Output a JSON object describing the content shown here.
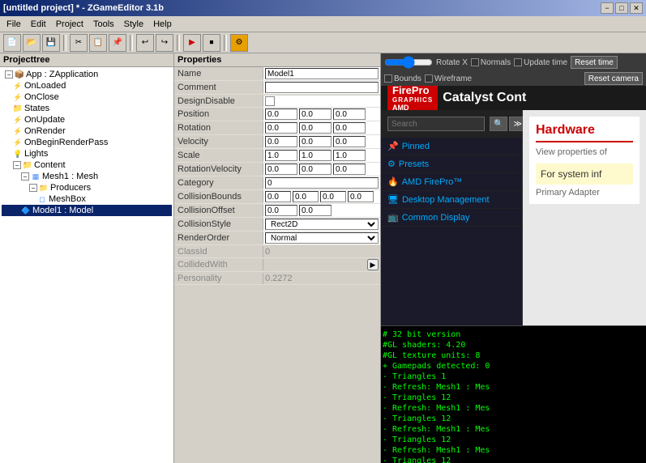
{
  "window": {
    "title": "[untitled project] * - ZGameEditor 3.1b",
    "min_btn": "−",
    "max_btn": "□",
    "close_btn": "✕"
  },
  "menu": {
    "items": [
      "File",
      "Edit",
      "Project",
      "Tools",
      "Style",
      "Help"
    ]
  },
  "toolbar": {
    "buttons": [
      "📁",
      "💾",
      "✂",
      "📋",
      "⎌",
      "⎚",
      "▶",
      "⏹",
      "🔍",
      "⚙"
    ]
  },
  "project_tree": {
    "header": "Projecttree",
    "items": [
      {
        "label": "App : ZApplication",
        "level": 0,
        "expanded": true,
        "icon": "app"
      },
      {
        "label": "OnLoaded",
        "level": 1,
        "icon": "event"
      },
      {
        "label": "OnClose",
        "level": 1,
        "icon": "event"
      },
      {
        "label": "States",
        "level": 1,
        "icon": "folder"
      },
      {
        "label": "OnUpdate",
        "level": 1,
        "icon": "event"
      },
      {
        "label": "OnRender",
        "level": 1,
        "icon": "event"
      },
      {
        "label": "OnBeginRenderPass",
        "level": 1,
        "icon": "event"
      },
      {
        "label": "Lights",
        "level": 1,
        "icon": "light"
      },
      {
        "label": "Content",
        "level": 1,
        "expanded": true,
        "icon": "folder"
      },
      {
        "label": "Mesh1 : Mesh",
        "level": 2,
        "expanded": true,
        "icon": "mesh"
      },
      {
        "label": "Producers",
        "level": 3,
        "expanded": true,
        "icon": "folder"
      },
      {
        "label": "MeshBox",
        "level": 4,
        "icon": "meshbox"
      },
      {
        "label": "Model1 : Model",
        "level": 2,
        "selected": true,
        "icon": "model"
      }
    ]
  },
  "properties": {
    "header": "Properties",
    "fields": [
      {
        "label": "Name",
        "value": "Model1",
        "type": "text"
      },
      {
        "label": "Comment",
        "value": "",
        "type": "text"
      },
      {
        "label": "DesignDisable",
        "value": "",
        "type": "checkbox"
      },
      {
        "label": "Position",
        "value": [
          "0.0",
          "0.0",
          "0.0"
        ],
        "type": "triple"
      },
      {
        "label": "Rotation",
        "value": [
          "0.0",
          "0.0",
          "0.0"
        ],
        "type": "triple"
      },
      {
        "label": "Velocity",
        "value": [
          "0.0",
          "0.0",
          "0.0"
        ],
        "type": "triple"
      },
      {
        "label": "Scale",
        "value": [
          "1.0",
          "1.0",
          "1.0"
        ],
        "type": "triple"
      },
      {
        "label": "RotationVelocity",
        "value": [
          "0.0",
          "0.0",
          "0.0"
        ],
        "type": "triple"
      },
      {
        "label": "Category",
        "value": "0",
        "type": "text"
      },
      {
        "label": "CollisionBounds",
        "value": [
          "0.0",
          "0.0",
          "0.0",
          "0.0"
        ],
        "type": "quad"
      },
      {
        "label": "CollisionOffset",
        "value": [
          "0.0",
          "0.0"
        ],
        "type": "double"
      },
      {
        "label": "CollisionStyle",
        "value": "Rect2D",
        "type": "dropdown"
      },
      {
        "label": "RenderOrder",
        "value": "Normal",
        "type": "dropdown"
      },
      {
        "label": "ClassId",
        "value": "0",
        "type": "disabled"
      },
      {
        "label": "CollidedWith",
        "value": "",
        "type": "disabled"
      },
      {
        "label": "Personality",
        "value": "0.2272",
        "type": "disabled"
      }
    ]
  },
  "viewport": {
    "rotate_x_label": "Rotate X",
    "normals_label": "Normals",
    "bounds_label": "Bounds",
    "update_time_label": "Update time",
    "wireframe_label": "Wireframe",
    "reset_time_btn": "Reset time",
    "reset_camera_btn": "Reset camera"
  },
  "amd": {
    "search_placeholder": "Search",
    "menu_items": [
      "Pinned",
      "Presets",
      "AMD FirePro™",
      "Desktop Management",
      "Common Display"
    ],
    "hardware_title": "Hardware",
    "view_props_text": "View properties of",
    "catalyst_title": "Catalyst Cont",
    "for_system_text": "For system inf",
    "primary_adapter_text": "Primary Adapter",
    "firepro_text": "FirePro",
    "graphics_text": "GRAPHICS",
    "amd_text": "AMD"
  },
  "log": {
    "lines": [
      "# 32 bit version",
      "#GL shaders: 4.20",
      "#GL texture units: 8",
      "+ Gamepads detected: 0",
      "- Triangles 1",
      "- Refresh: Mesh1 : Mes",
      "- Triangles 12",
      "- Refresh: Mesh1 : Mes",
      "- Triangles 12",
      "- Refresh: Mesh1 : Mes",
      "- Triangles 12",
      "- Refresh: Mesh1 : Mes",
      "- Triangles 12"
    ]
  },
  "colors": {
    "amd_red": "#cc0000",
    "tree_selected_bg": "#0a246a",
    "log_bg": "#000000",
    "log_text": "#00ff00"
  }
}
